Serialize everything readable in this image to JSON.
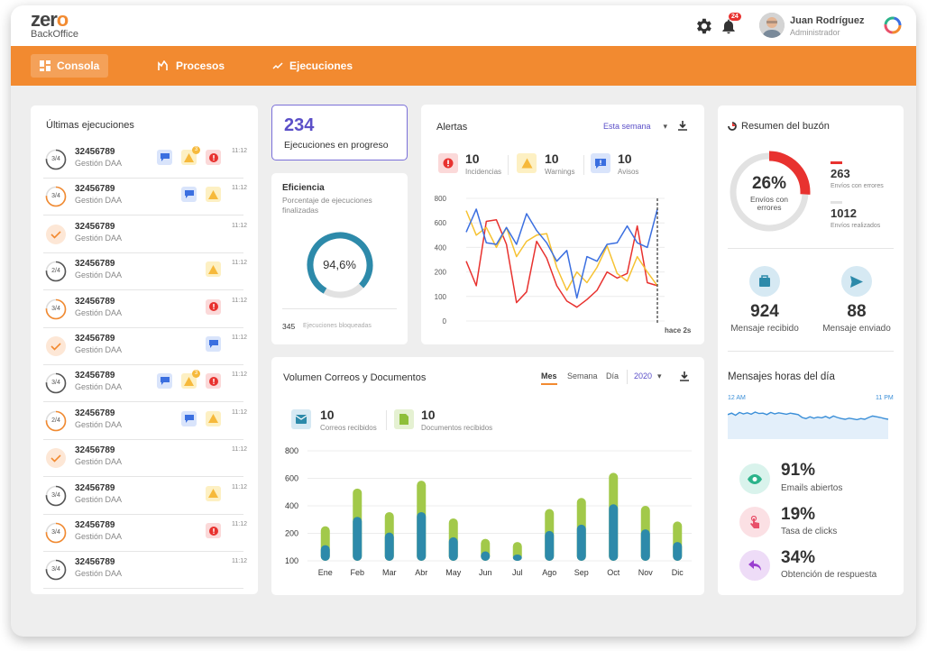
{
  "brand": {
    "logo_main_a": "zer",
    "logo_main_b": "o",
    "logo_sub": "BackOffice"
  },
  "header": {
    "notifications_count": "24",
    "user_name": "Juan Rodríguez",
    "user_role": "Administrador"
  },
  "nav": [
    {
      "label": "Consola",
      "icon": "dashboard-icon",
      "active": true
    },
    {
      "label": "Procesos",
      "icon": "process-icon",
      "active": false
    },
    {
      "label": "Ejecuciones",
      "icon": "trend-icon",
      "active": false
    }
  ],
  "executions": {
    "title": "Últimas ejecuciones",
    "rows": [
      {
        "step": "3/4",
        "id": "32456789",
        "sub": "Gestión DAA",
        "time": "11:12",
        "badges": [
          "blue",
          "yellow-dot",
          "red"
        ]
      },
      {
        "step": "3/4",
        "id": "32456789",
        "sub": "Gestión DAA",
        "time": "11:12",
        "badges": [
          "blue",
          "yellow"
        ]
      },
      {
        "step": "check",
        "id": "32456789",
        "sub": "Gestión DAA",
        "time": "11:12",
        "badges": []
      },
      {
        "step": "2/4",
        "id": "32456789",
        "sub": "Gestión DAA",
        "time": "11:12",
        "badges": [
          "yellow"
        ]
      },
      {
        "step": "3/4",
        "id": "32456789",
        "sub": "Gestión DAA",
        "time": "11:12",
        "badges": [
          "red"
        ]
      },
      {
        "step": "check",
        "id": "32456789",
        "sub": "Gestión DAA",
        "time": "11:12",
        "badges": [
          "blue"
        ]
      },
      {
        "step": "3/4",
        "id": "32456789",
        "sub": "Gestión DAA",
        "time": "11:12",
        "badges": [
          "blue",
          "yellow-dot",
          "red"
        ]
      },
      {
        "step": "2/4",
        "id": "32456789",
        "sub": "Gestión DAA",
        "time": "11:12",
        "badges": [
          "blue",
          "yellow"
        ]
      },
      {
        "step": "check",
        "id": "32456789",
        "sub": "Gestión DAA",
        "time": "11:12",
        "badges": []
      },
      {
        "step": "3/4",
        "id": "32456789",
        "sub": "Gestión DAA",
        "time": "11:12",
        "badges": [
          "yellow"
        ]
      },
      {
        "step": "3/4",
        "id": "32456789",
        "sub": "Gestión DAA",
        "time": "11:12",
        "badges": [
          "red"
        ]
      },
      {
        "step": "3/4",
        "id": "32456789",
        "sub": "Gestión DAA",
        "time": "11:12",
        "badges": []
      }
    ],
    "dot_count": "3"
  },
  "in_progress": {
    "value": "234",
    "label": "Ejecuciones en progreso"
  },
  "efficiency": {
    "title": "Eficiencia",
    "subtitle_1": "Porcentaje de ejecuciones",
    "subtitle_2": "finalizadas",
    "value": "94,6%",
    "fraction": 0.946,
    "blocked_count": "345",
    "blocked_label": "Ejecuciones bloqueadas"
  },
  "alerts": {
    "title": "Alertas",
    "period": "Esta semana",
    "summary": [
      {
        "value": "10",
        "label": "Incidencias",
        "color": "#e8322f"
      },
      {
        "value": "10",
        "label": "Warnings",
        "color": "#f6b93b"
      },
      {
        "value": "10",
        "label": "Avisos",
        "color": "#3b6fe0"
      }
    ],
    "now_label": "hace 2s"
  },
  "mailbox": {
    "title": "Resumen del buzón",
    "pct": "26%",
    "pct_label_1": "Envíos con",
    "pct_label_2": "errores",
    "fraction": 0.26,
    "errors_count": "263",
    "errors_label": "Envíos con errores",
    "done_count": "1012",
    "done_label": "Envíos realizados",
    "received_count": "924",
    "received_label": "Mensaje recibido",
    "sent_count": "88",
    "sent_label": "Mensaje enviado"
  },
  "hours": {
    "title": "Mensajes horas del día",
    "start_label": "12 AM",
    "end_label": "11 PM",
    "values": [
      68,
      72,
      66,
      74,
      70,
      73,
      69,
      75,
      71,
      72,
      68,
      74,
      70,
      73,
      71,
      69,
      72,
      70,
      68,
      60,
      57,
      62,
      58,
      61,
      59,
      63,
      58,
      64,
      60,
      57,
      55,
      58,
      56,
      54,
      57,
      55,
      60,
      64,
      62,
      60,
      57,
      55
    ]
  },
  "stats": [
    {
      "value": "91%",
      "label": "Emails abiertos",
      "icon": "eye-icon",
      "bg": "#d9f3ec",
      "fg": "#2bb38a"
    },
    {
      "value": "19%",
      "label": "Tasa de clicks",
      "icon": "touch-icon",
      "bg": "#fbe0e4",
      "fg": "#e8506a"
    },
    {
      "value": "34%",
      "label": "Obtención de respuesta",
      "icon": "reply-icon",
      "bg": "#eedcf7",
      "fg": "#9b3fd0"
    }
  ],
  "volume": {
    "title": "Volumen Correos y Documentos",
    "tabs": [
      "Mes",
      "Semana",
      "Día"
    ],
    "year": "2020",
    "mail_count": "10",
    "mail_label": "Correos recibidos",
    "docs_count": "10",
    "docs_label": "Documentos recibidos"
  },
  "chart_data": [
    {
      "type": "line",
      "title": "Alertas",
      "ylim": [
        0,
        800
      ],
      "yticks": [
        "800",
        "600",
        "400",
        "200",
        "100",
        "0"
      ],
      "x": [
        1,
        2,
        3,
        4,
        5,
        6,
        7,
        8,
        9,
        10,
        11,
        12,
        13,
        14,
        15,
        16,
        17,
        18,
        19,
        20
      ],
      "series": [
        {
          "values": [
            390,
            230,
            650,
            660,
            500,
            120,
            190,
            520,
            410,
            230,
            130,
            90,
            140,
            200,
            320,
            280,
            310,
            620,
            250,
            230
          ],
          "color": "#e8322f"
        },
        {
          "values": [
            720,
            560,
            610,
            480,
            610,
            420,
            520,
            560,
            570,
            350,
            200,
            320,
            250,
            350,
            490,
            310,
            260,
            420,
            320,
            230
          ],
          "color": "#f6c232"
        },
        {
          "values": [
            580,
            730,
            510,
            500,
            610,
            500,
            700,
            590,
            510,
            390,
            460,
            150,
            420,
            390,
            500,
            510,
            620,
            510,
            480,
            730
          ],
          "color": "#3b6fe0"
        }
      ]
    },
    {
      "type": "bar",
      "title": "Volumen Correos y Documentos",
      "categories": [
        "Ene",
        "Feb",
        "Mar",
        "Abr",
        "May",
        "Jun",
        "Jul",
        "Ago",
        "Sep",
        "Oct",
        "Nov",
        "Dic"
      ],
      "ylim": [
        100,
        800
      ],
      "yticks": [
        "800",
        "600",
        "400",
        "200",
        "100"
      ],
      "series": [
        {
          "values": [
            200,
            380,
            280,
            410,
            250,
            160,
            140,
            290,
            330,
            460,
            300,
            220
          ],
          "color": "#2d8aaa"
        },
        {
          "values": [
            320,
            560,
            410,
            610,
            370,
            240,
            220,
            430,
            500,
            660,
            450,
            350
          ],
          "color": "#a2c94a"
        }
      ]
    }
  ]
}
